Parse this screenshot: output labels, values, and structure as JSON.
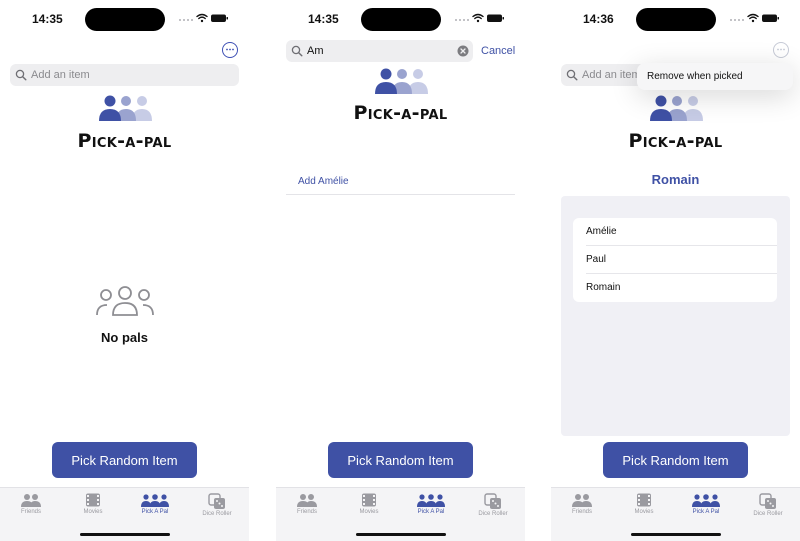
{
  "colors": {
    "accent": "#3f51a5",
    "accent_light": "#9aa3cf",
    "accent_lighter": "#c7cce6",
    "gray_icon": "#8e8e93",
    "list_background": "#f0f0f5"
  },
  "app": {
    "title": "Pick-a-pal",
    "pick_button_label": "Pick Random Item",
    "search_placeholder": "Add an item",
    "tabs": [
      {
        "label": "Friends",
        "icon": "person-2-icon"
      },
      {
        "label": "Movies",
        "icon": "film-icon"
      },
      {
        "label": "Pick A Pal",
        "icon": "person-3-icon"
      },
      {
        "label": "Dice Roller",
        "icon": "dice-icon"
      }
    ]
  },
  "screen1": {
    "time": "14:35",
    "empty_label": "No pals"
  },
  "screen2": {
    "time": "14:35",
    "search_value": "Am",
    "cancel_label": "Cancel",
    "suggestion": "Add Amélie"
  },
  "screen3": {
    "time": "14:36",
    "search_placeholder_visible": "Add an item",
    "menu_item": "Remove when picked",
    "picked_name": "Romain",
    "items": [
      "Amélie",
      "Paul",
      "Romain"
    ]
  }
}
